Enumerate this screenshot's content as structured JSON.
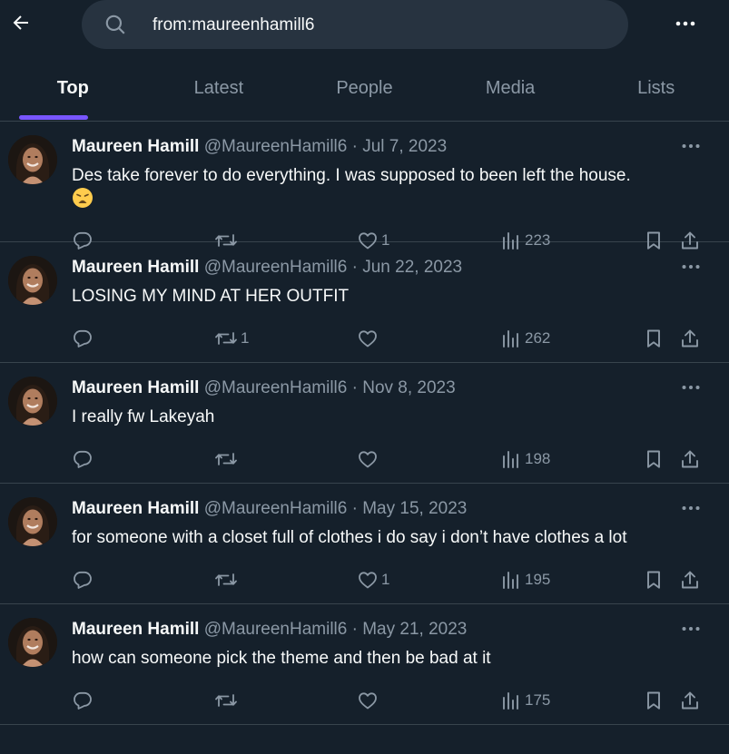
{
  "search": {
    "query": "from:maureenhamill6"
  },
  "tabs": [
    {
      "label": "Top",
      "active": true
    },
    {
      "label": "Latest",
      "active": false
    },
    {
      "label": "People",
      "active": false
    },
    {
      "label": "Media",
      "active": false
    },
    {
      "label": "Lists",
      "active": false
    }
  ],
  "colors": {
    "background": "#15202b",
    "accent": "#7856ff",
    "muted_text": "#8b98a5",
    "divider": "#38444d"
  },
  "tweets": [
    {
      "name": "Maureen Hamill",
      "handle": "@MaureenHamill6",
      "separator": "·",
      "date": "Jul 7, 2023",
      "text": "Des take forever to do everything. I was supposed to been left the house.",
      "emoji": "weary-face-emoji",
      "replies": "",
      "retweets": "",
      "likes": "1",
      "views": "223"
    },
    {
      "name": "Maureen Hamill",
      "handle": "@MaureenHamill6",
      "separator": "·",
      "date": "Jun 22, 2023",
      "text": "LOSING MY MIND AT HER OUTFIT",
      "replies": "",
      "retweets": "1",
      "likes": "",
      "views": "262"
    },
    {
      "name": "Maureen Hamill",
      "handle": "@MaureenHamill6",
      "separator": "·",
      "date": "Nov 8, 2023",
      "text": "I really fw Lakeyah",
      "replies": "",
      "retweets": "",
      "likes": "",
      "views": "198"
    },
    {
      "name": "Maureen Hamill",
      "handle": "@MaureenHamill6",
      "separator": "·",
      "date": "May 15, 2023",
      "text": "for someone with a closet full of clothes i do say i don’t have clothes a lot",
      "replies": "",
      "retweets": "",
      "likes": "1",
      "views": "195"
    },
    {
      "name": "Maureen Hamill",
      "handle": "@MaureenHamill6",
      "separator": "·",
      "date": "May 21, 2023",
      "text": "how can someone pick the theme and then be bad at it",
      "replies": "",
      "retweets": "",
      "likes": "",
      "views": "175"
    }
  ]
}
